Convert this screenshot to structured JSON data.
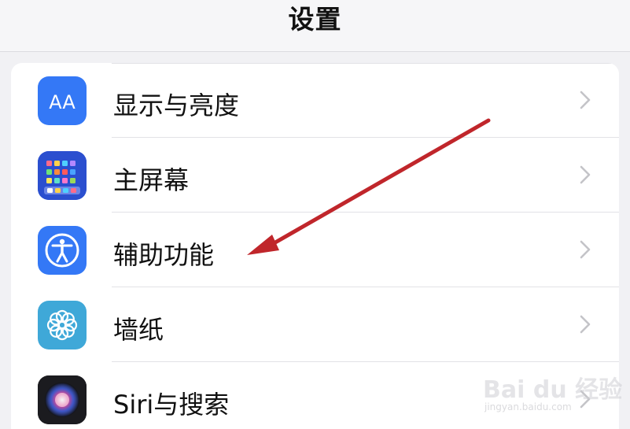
{
  "nav": {
    "title": "设置"
  },
  "rows": [
    {
      "label": "显示与亮度",
      "icon": "display-brightness-icon",
      "icon_color": "#3478f6"
    },
    {
      "label": "主屏幕",
      "icon": "home-screen-icon",
      "icon_color": "#2d5bd6"
    },
    {
      "label": "辅助功能",
      "icon": "accessibility-icon",
      "icon_color": "#3478f6"
    },
    {
      "label": "墙纸",
      "icon": "wallpaper-icon",
      "icon_color": "#3fa8d8"
    },
    {
      "label": "Siri与搜索",
      "icon": "siri-icon",
      "icon_color": "#222222"
    }
  ],
  "icon_texts": {
    "display": "AA"
  },
  "annotation": {
    "type": "arrow",
    "color": "#c0262b",
    "points_to": "辅助功能"
  },
  "watermark": {
    "main": "Bai du 经验",
    "sub": "jingyan.baidu.com"
  }
}
